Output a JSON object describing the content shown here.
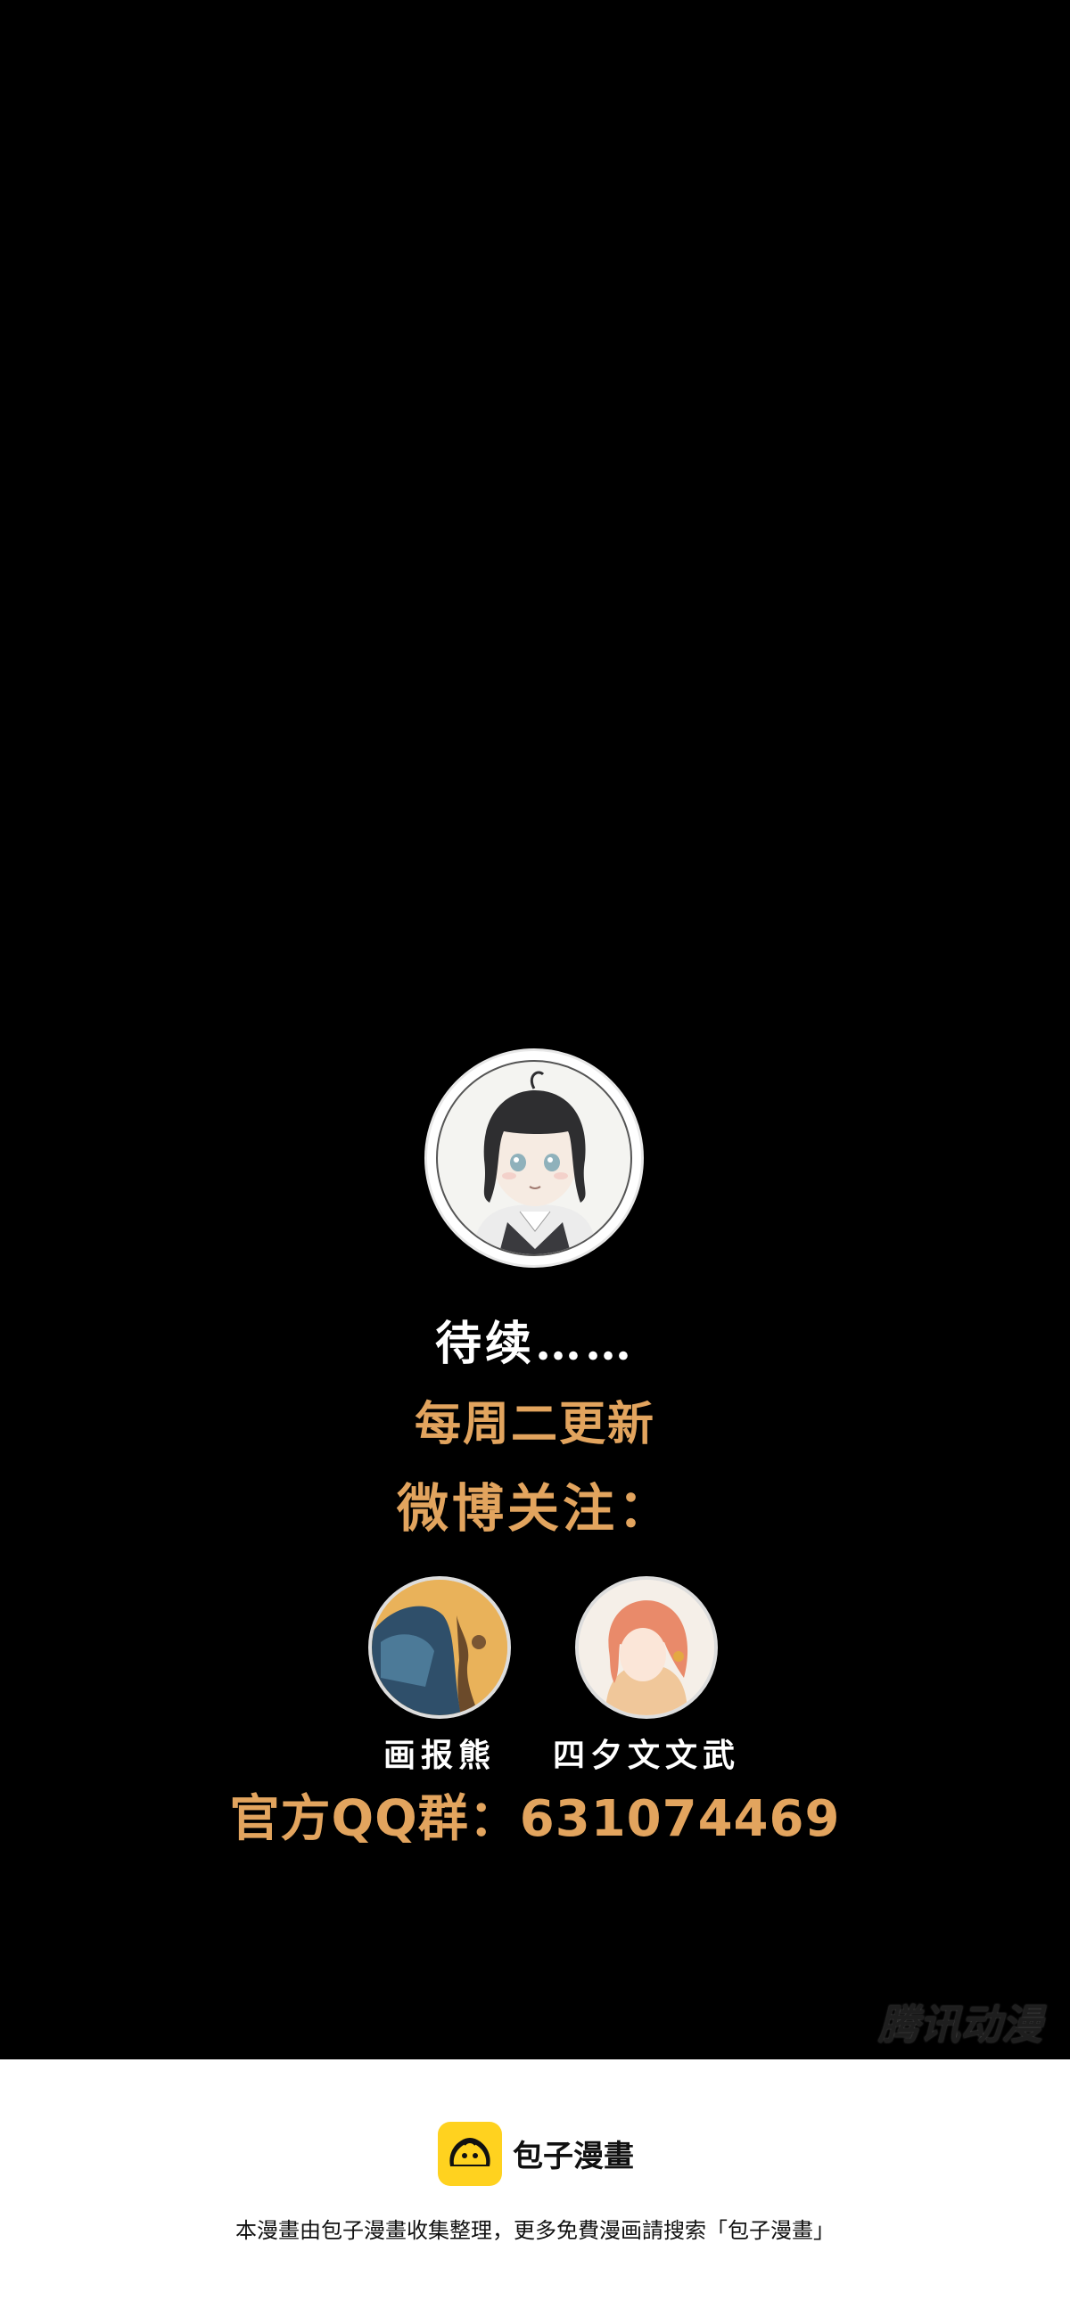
{
  "ending": {
    "to_be_continued": "待续……",
    "schedule": "每周二更新",
    "weibo_follow": "微博关注：",
    "authors": [
      {
        "name": "画报熊"
      },
      {
        "name": "四夕文文武"
      }
    ],
    "qq_group": "官方QQ群：631074469"
  },
  "watermark": "腾讯动漫",
  "footer": {
    "brand": "包子漫畫",
    "notice": "本漫畫由包子漫畫收集整理，更多免費漫画請搜索「包子漫畫」",
    "logo_color": "#ffd21f"
  },
  "colors": {
    "background": "#000000",
    "accent_orange": "#e2a45e",
    "footer_bg": "#ffffff"
  }
}
